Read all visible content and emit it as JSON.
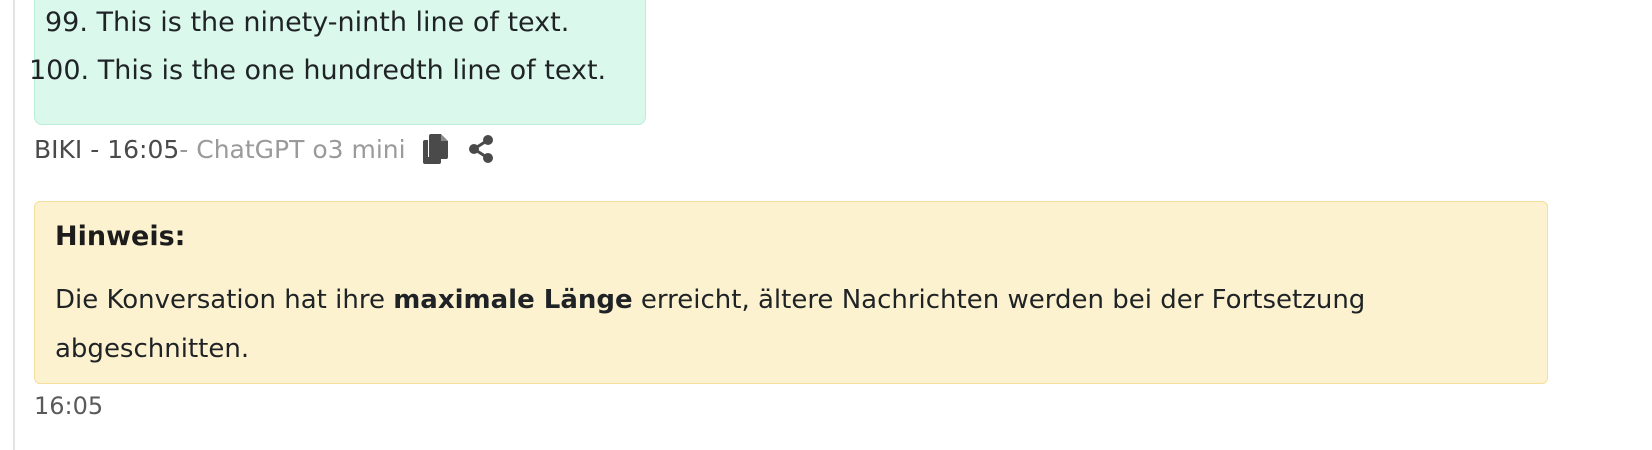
{
  "message": {
    "lines": [
      {
        "number": "99.",
        "text": "This is the ninety-ninth line of text."
      },
      {
        "number": "100.",
        "text": "This is the one hundredth line of text."
      }
    ],
    "meta": {
      "author_time": "BIKI - 16:05",
      "model": " - ChatGPT o3 mini",
      "copy_icon": "copy-icon",
      "share_icon": "share-icon"
    }
  },
  "notice": {
    "title": "Hinweis:",
    "text_before": "Die Konversation hat ihre ",
    "text_bold": "maximale Länge",
    "text_after": " erreicht, ältere Nachrichten werden bei der Fortsetzung abgeschnitten.",
    "time": "16:05"
  },
  "colors": {
    "bubble_bg": "#dbf8ec",
    "notice_bg": "#fcf2d0",
    "notice_border": "#f5df9c"
  }
}
